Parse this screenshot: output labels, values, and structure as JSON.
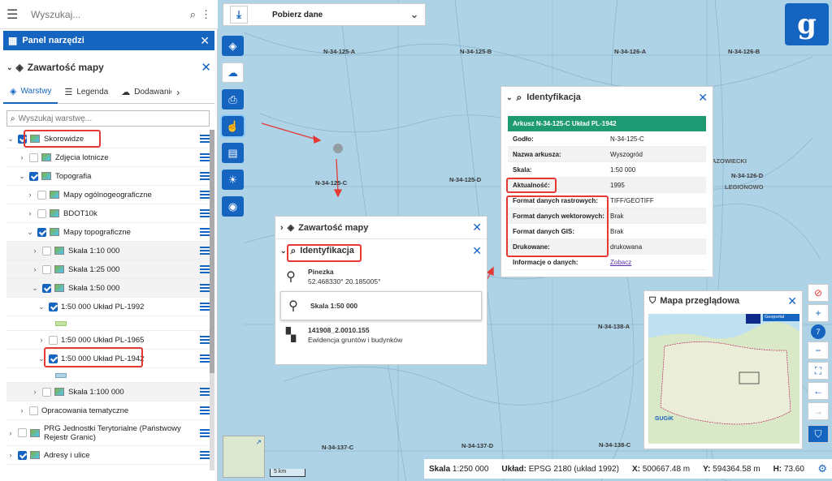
{
  "search": {
    "placeholder": "Wyszukaj..."
  },
  "panel": {
    "title": "Panel narzędzi"
  },
  "map_content": {
    "title": "Zawartość mapy"
  },
  "tabs": [
    {
      "label": "Warstwy",
      "icon": "layers-icon"
    },
    {
      "label": "Legenda",
      "icon": "list-icon"
    },
    {
      "label": "Dodawanie",
      "icon": "cloud-upload-icon"
    }
  ],
  "layer_search": {
    "placeholder": "Wyszukaj warstwę..."
  },
  "layers": [
    {
      "label": "Skorowidze",
      "checked": true
    },
    {
      "label": "Zdjęcia lotnicze",
      "checked": false
    },
    {
      "label": "Topografia",
      "checked": true
    },
    {
      "label": "Mapy ogólnogeograficzne",
      "checked": false
    },
    {
      "label": "BDOT10k",
      "checked": false
    },
    {
      "label": "Mapy topograficzne",
      "checked": true
    },
    {
      "label": "Skala 1:10 000",
      "checked": false
    },
    {
      "label": "Skala 1:25 000",
      "checked": false
    },
    {
      "label": "Skala 1:50 000",
      "checked": true
    },
    {
      "label": "1:50 000 Układ PL-1992",
      "checked": true
    },
    {
      "label": "1:50 000 Układ PL-1965",
      "checked": false
    },
    {
      "label": "1:50 000 Układ PL-1942",
      "checked": true
    },
    {
      "label": "Skala 1:100 000",
      "checked": false
    },
    {
      "label": "Opracowania tematyczne",
      "checked": false
    },
    {
      "label": "PRG Jednostki Terytorialne (Państwowy Rejestr Granic)",
      "checked": false
    },
    {
      "label": "Adresy i ulice",
      "checked": true
    }
  ],
  "topbar": {
    "label": "Pobierz dane"
  },
  "map_labels": [
    "N-34-125-A",
    "N-34-125-B",
    "N-34-126-A",
    "N-34-126-B",
    "N-34-125-C",
    "N-34-125-D",
    "N-34-126-D",
    "N-34-138-A",
    "N-34-137-C",
    "N-34-137-D",
    "N-34-138-C",
    "AZOWIECKI",
    "LEGIONOWO"
  ],
  "identification": {
    "title": "Identyfikacja",
    "record_title": "Arkusz N-34-125-C Układ PL-1942",
    "rows": [
      {
        "key": "Godło:",
        "value": "N-34-125-C"
      },
      {
        "key": "Nazwa arkusza:",
        "value": "Wyszogród"
      },
      {
        "key": "Skala:",
        "value": "1:50 000"
      },
      {
        "key": "Aktualność:",
        "value": "1995"
      },
      {
        "key": "Format danych rastrowych:",
        "value": "TIFF/GEOTIFF"
      },
      {
        "key": "Format danych wektorowych:",
        "value": "Brak"
      },
      {
        "key": "Format danych GIS:",
        "value": "Brak"
      },
      {
        "key": "Drukowane:",
        "value": "drukowana"
      },
      {
        "key": "Informacje o danych:",
        "value": "Zobacz"
      }
    ]
  },
  "popup": {
    "content_title": "Zawartość mapy",
    "ident_title": "Identyfikacja",
    "items": [
      {
        "title": "Pinezka",
        "sub": "52.468330° 20.185005°",
        "icon": "pin-icon"
      },
      {
        "title": "Skala 1:50 000",
        "sub": "",
        "icon": "pin-icon"
      },
      {
        "title": "141908_2.0010.155",
        "sub": "Ewidencja gruntów i budynków",
        "icon": "parcel-icon"
      }
    ]
  },
  "overview": {
    "title": "Mapa przeglądowa",
    "badge": "GUGiK",
    "inset_label": "Geoportal",
    "logo_text": "GUGiK"
  },
  "zoom": {
    "level": "7"
  },
  "status": {
    "scale_label": "Skala",
    "scale_value": "1:250 000",
    "crs_label": "Układ:",
    "crs_value": "EPSG 2180 (układ 1992)",
    "x_label": "X:",
    "x_value": "500667.48 m",
    "y_label": "Y:",
    "y_value": "594364.58 m",
    "h_label": "H:",
    "h_value": "73.60"
  },
  "scalebar": {
    "label": "5 km"
  },
  "colors": {
    "accent": "#1565c0",
    "highlight": "#e53935",
    "record": "#1e9b73",
    "map": "#aed3e6"
  }
}
